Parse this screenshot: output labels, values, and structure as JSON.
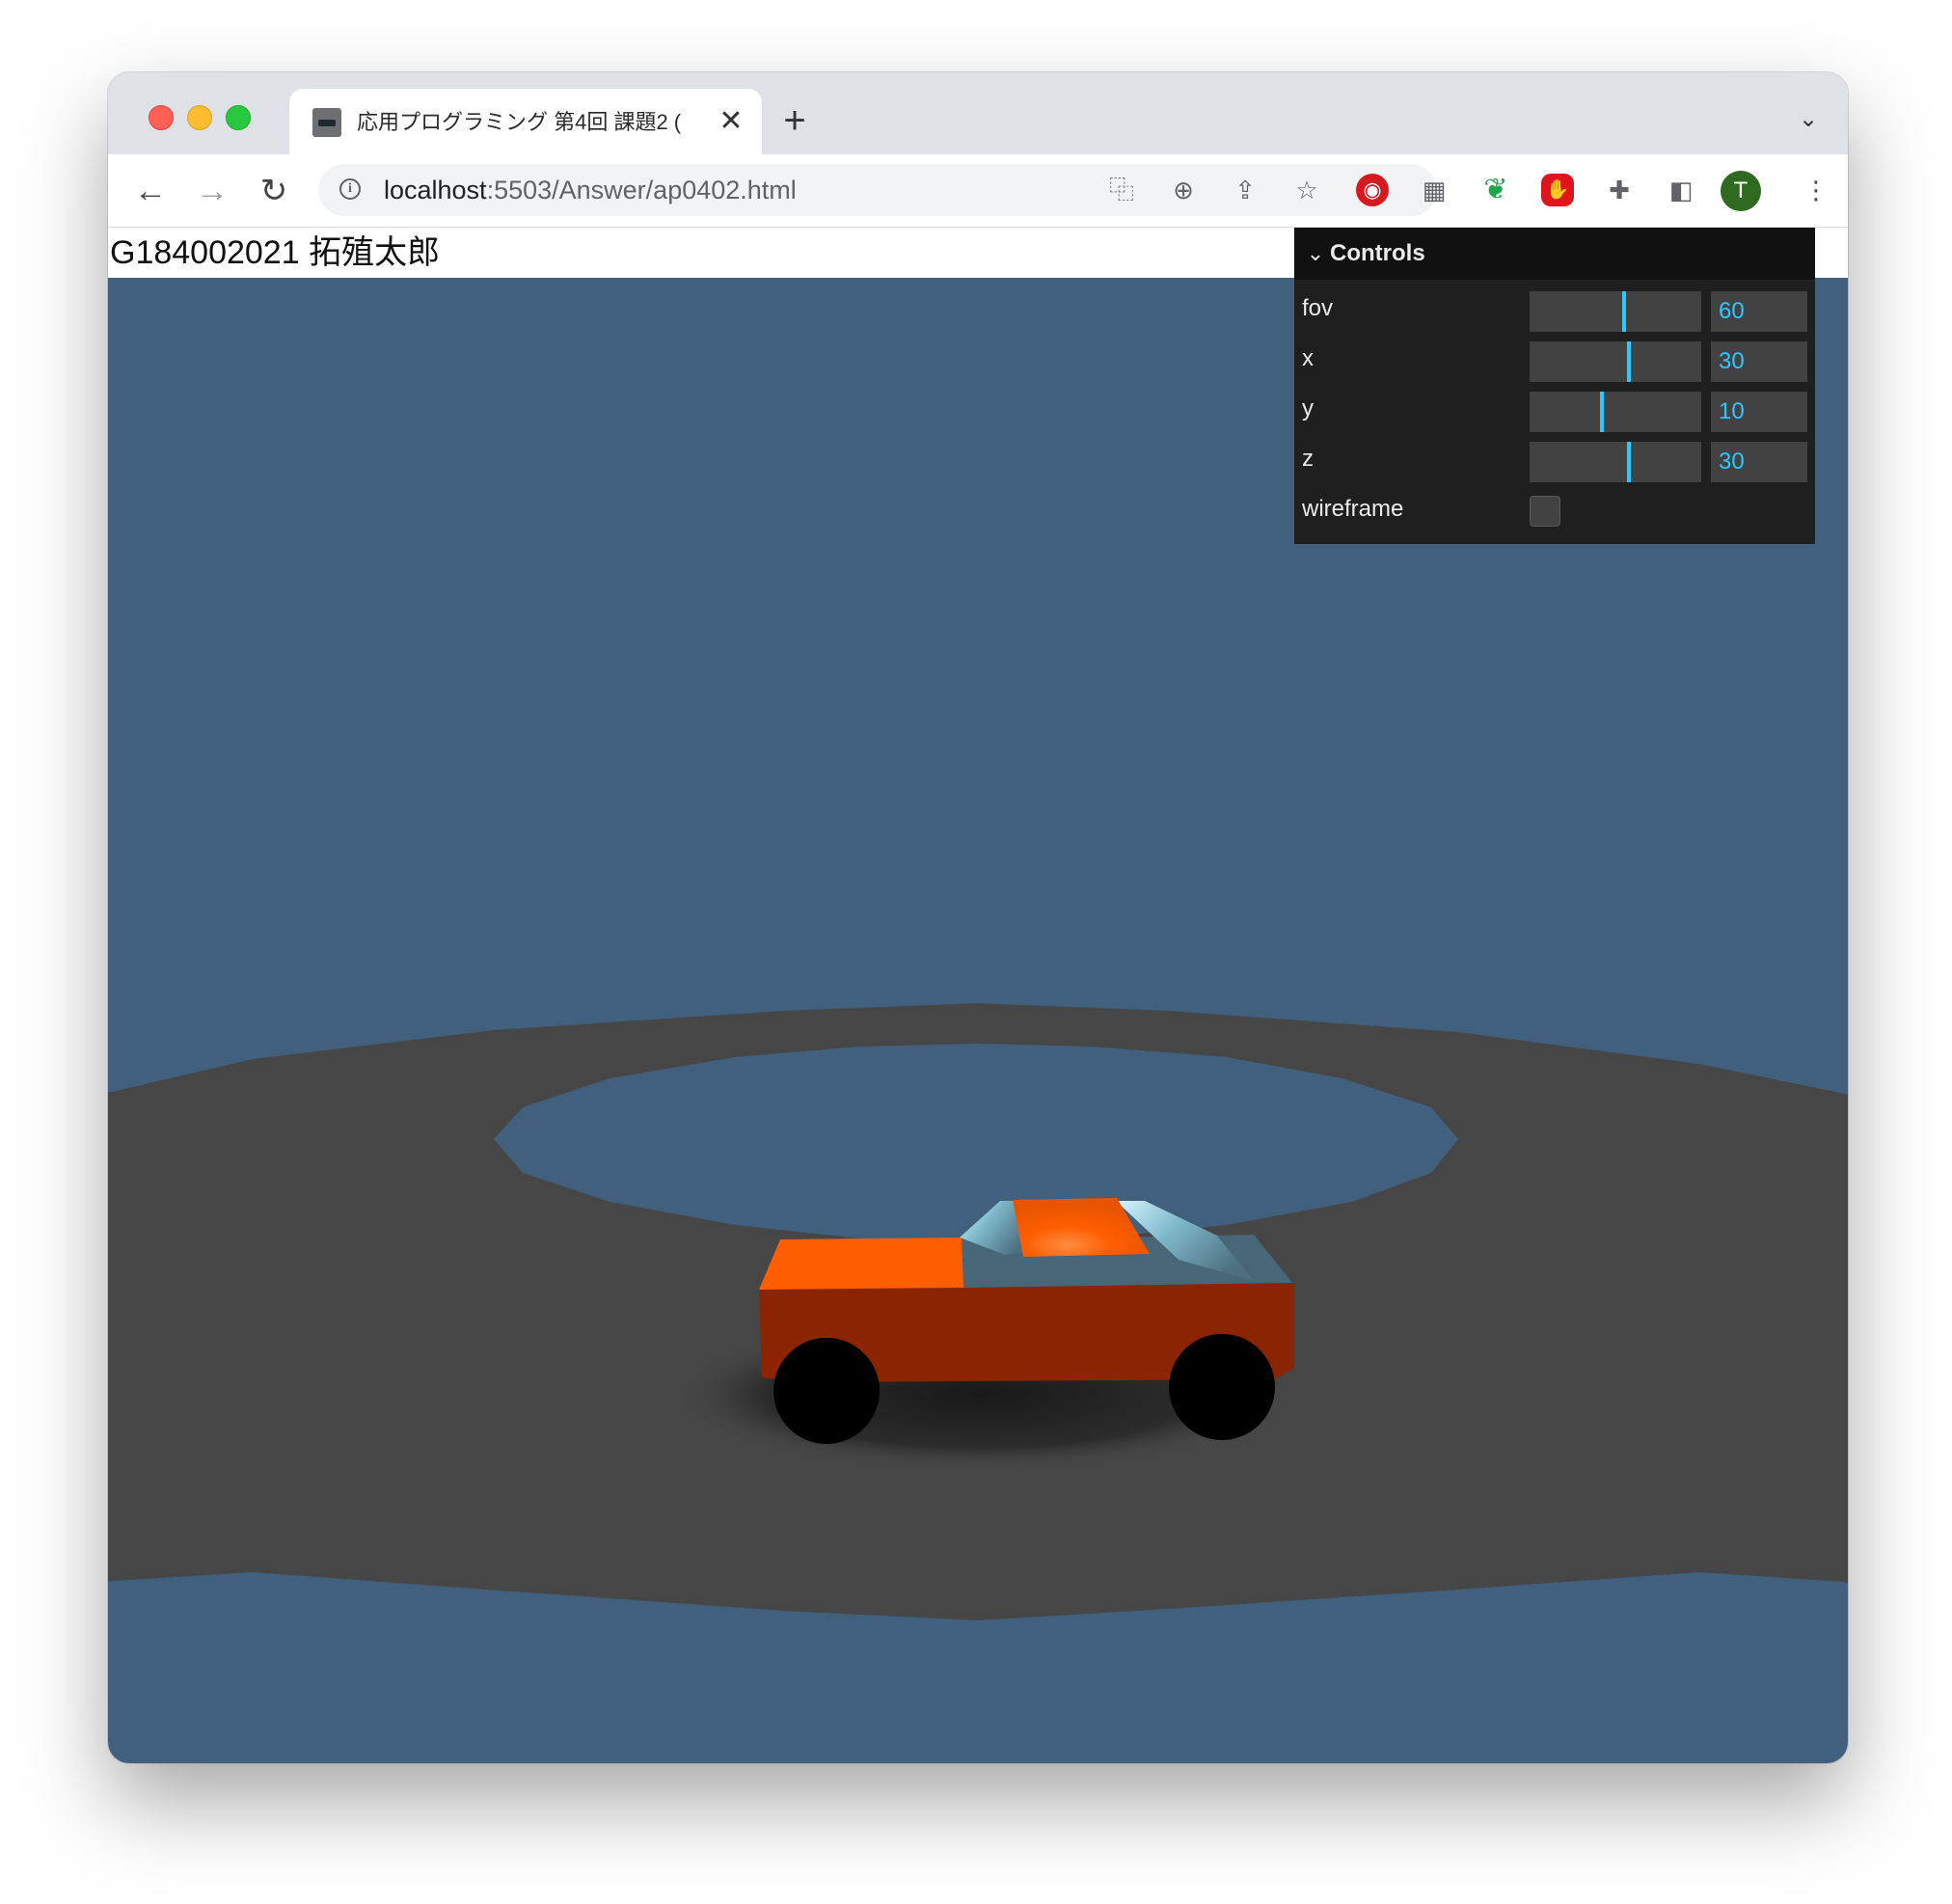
{
  "browser": {
    "tab_title": "応用プログラミング 第4回 課題2 (",
    "tab_close": "✕",
    "new_tab": "+",
    "tab_search": "⌄",
    "url_host": "localhost",
    "url_rest": ":5503/Answer/ap0402.html",
    "nav": {
      "back": "←",
      "forward": "→",
      "reload": "↻"
    },
    "omnibox_icons": {
      "info": "i",
      "translate": "⿻",
      "zoom": "⊕",
      "share": "⇪",
      "bookmark": "☆"
    },
    "extensions": [
      "red-circle-extension",
      "qr-code-extension",
      "evernote-extension",
      "stop-extension",
      "puzzle-extension",
      "side-panel-extension"
    ],
    "extension_glyphs": {
      "red": "◉",
      "qr": "▦",
      "green": "❦",
      "stop": "✋",
      "puzzle": "✚",
      "panel": "◧",
      "menu": "⋮"
    },
    "avatar_letter": "T"
  },
  "page": {
    "student": "G184002021 拓殖太郎",
    "scene_colors": {
      "background": "#41607e",
      "ground": "#464646",
      "car_body": "#8b2400",
      "car_top": "#ff5e00",
      "cabin": "#4a6878",
      "wheel": "#000000"
    }
  },
  "controls": {
    "title": "Controls",
    "chevron": "⌄",
    "rows": [
      {
        "label": "fov",
        "value": "60",
        "fraction": 0.55
      },
      {
        "label": "x",
        "value": "30",
        "fraction": 0.58
      },
      {
        "label": "y",
        "value": "10",
        "fraction": 0.42
      },
      {
        "label": "z",
        "value": "30",
        "fraction": 0.58
      }
    ],
    "wireframe_label": "wireframe",
    "wireframe_checked": false
  },
  "colors": {
    "accent": "#2cc9ff",
    "panel": "#1f1f1f"
  }
}
